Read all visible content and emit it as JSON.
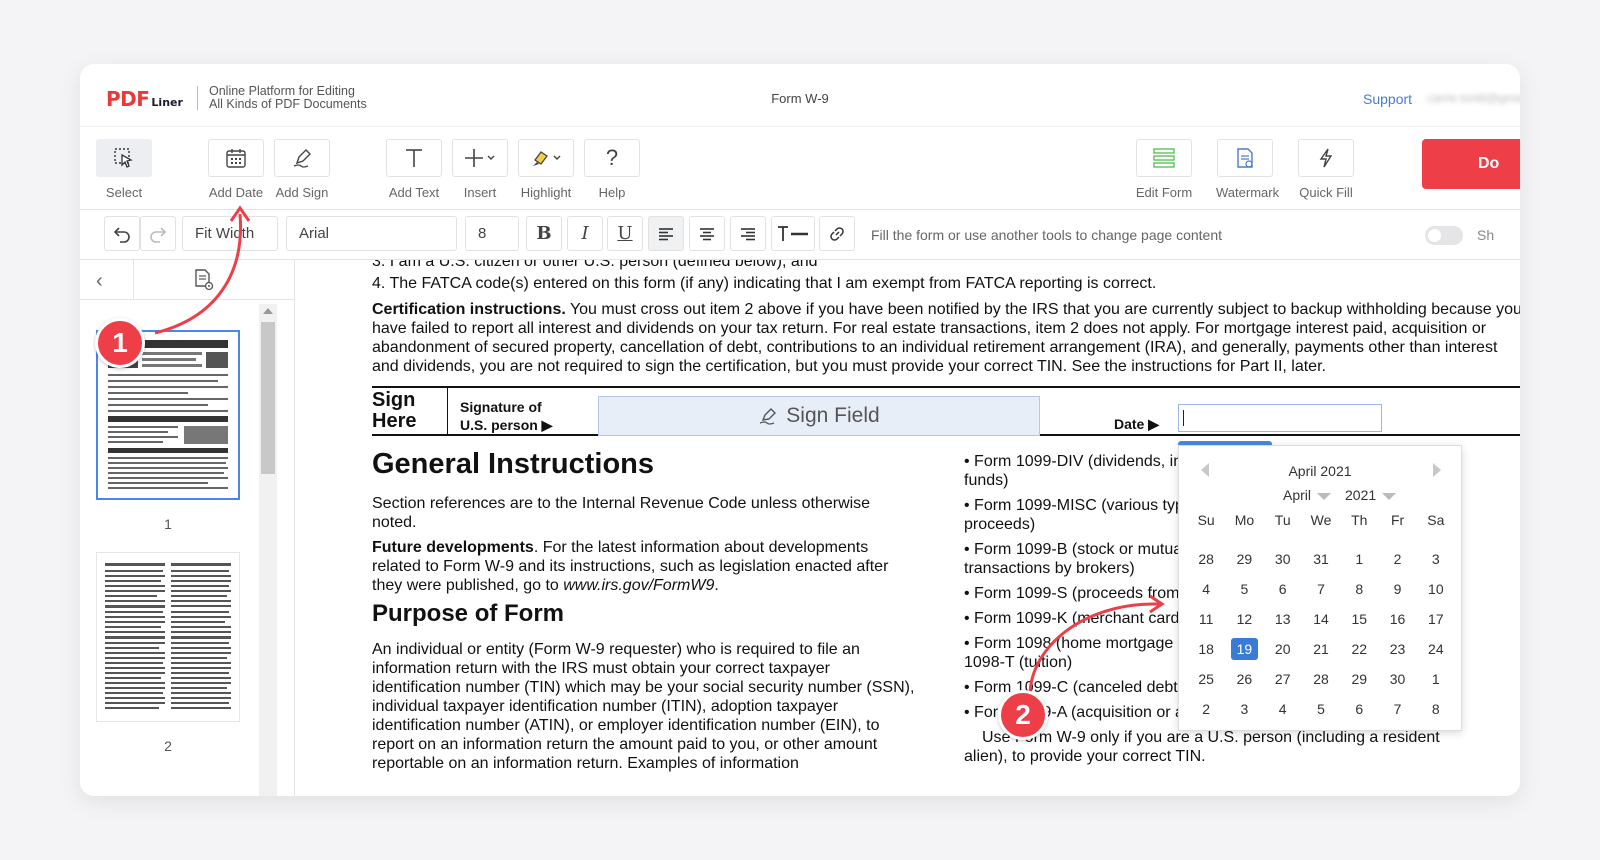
{
  "header": {
    "logo_main": "PDF",
    "logo_sub": "Liner",
    "tagline_line1": "Online Platform for Editing",
    "tagline_line2": "All Kinds of PDF Documents",
    "doc_title": "Form W-9",
    "support": "Support",
    "user_email": "carrie.tontit@gmail.com"
  },
  "toolbar": {
    "select": "Select",
    "add_date": "Add Date",
    "add_sign": "Add Sign",
    "add_text": "Add Text",
    "insert": "Insert",
    "highlight": "Highlight",
    "help": "Help",
    "edit_form": "Edit Form",
    "watermark": "Watermark",
    "quick_fill": "Quick Fill",
    "done": "Do"
  },
  "format": {
    "zoom": "Fit Width",
    "font": "Arial",
    "size": "8",
    "bold": "B",
    "italic": "I",
    "underline": "U",
    "hint": "Fill the form or use another tools to change page content",
    "toggle_label": "Sh"
  },
  "sidebar": {
    "pages": [
      "1",
      "2"
    ]
  },
  "document": {
    "line_top": "3. I am a U.S. citizen or other U.S. person (defined below); and",
    "line4": "4. The FATCA code(s) entered on this form (if any) indicating that I am exempt from FATCA reporting is correct.",
    "cert_bold": "Certification instructions.",
    "cert_text": " You must cross out item 2 above if you have been notified by the IRS that you are currently subject to backup withholding because you have failed to report all interest and dividends on your tax return. For real estate transactions, item 2 does not apply. For mortgage interest paid, acquisition or abandonment of secured property, cancellation of debt, contributions to an individual retirement arrangement (IRA), and generally, payments other than interest and dividends, you are not required to sign the certification, but you must provide your correct TIN. See the instructions for Part II, later.",
    "sign_here_1": "Sign",
    "sign_here_2": "Here",
    "sig_label_1": "Signature of",
    "sig_label_2": "U.S. person ▶",
    "sign_field": "Sign Field",
    "date_label": "Date ▶",
    "gi_title": "General Instructions",
    "gi_text": "Section references are to the Internal Revenue Code unless otherwise noted.",
    "fd_bold": "Future developments",
    "fd_text": ". For the latest information about developments related to Form W-9 and its instructions, such as legislation enacted after they were published, go to ",
    "fd_link": "www.irs.gov/FormW9",
    "fd_end": ".",
    "pf_title": "Purpose of Form",
    "pf_text": "An individual or entity (Form W-9 requester) who is required to file an information return with the IRS must obtain your correct taxpayer identification number (TIN) which may be your social security number (SSN), individual taxpayer identification number (ITIN), adoption taxpayer identification number (ATIN), or employer identification number (EIN), to report on an information return the amount paid to you, or other amount reportable on an information return. Examples of information",
    "bullets": [
      "• Form 1099-DIV (dividends, including those from stocks or mutual",
      "funds)",
      "• Form 1099-MISC (various types of income, prizes, awards, or gross",
      "proceeds)",
      "• Form 1099-B (stock or mutual fund sales and certain other",
      "transactions by brokers)",
      "• Form 1099-S (proceeds from real estate transactions)",
      "• Form 1099-K (merchant card and third party network transactions)",
      "• Form 1098 (home mortgage interest), 1098-E (student loan interest),",
      "1098-T (tuition)",
      "• Form 1099-C (canceled debt)",
      "• Form 1099-A (acquisition or abandonment of secured property)"
    ],
    "use_text_1": "Use Form W-9 only if you are a U.S. person (including a resident",
    "use_text_2": "alien), to provide your correct TIN."
  },
  "calendar": {
    "title": "April 2021",
    "month": "April",
    "year": "2021",
    "dow": [
      "Su",
      "Mo",
      "Tu",
      "We",
      "Th",
      "Fr",
      "Sa"
    ],
    "weeks": [
      [
        "28",
        "29",
        "30",
        "31",
        "1",
        "2",
        "3"
      ],
      [
        "4",
        "5",
        "6",
        "7",
        "8",
        "9",
        "10"
      ],
      [
        "11",
        "12",
        "13",
        "14",
        "15",
        "16",
        "17"
      ],
      [
        "18",
        "19",
        "20",
        "21",
        "22",
        "23",
        "24"
      ],
      [
        "25",
        "26",
        "27",
        "28",
        "29",
        "30",
        "1"
      ],
      [
        "2",
        "3",
        "4",
        "5",
        "6",
        "7",
        "8"
      ]
    ],
    "today": "19"
  },
  "annotations": {
    "step1": "1",
    "step2": "2"
  },
  "colors": {
    "brand": "#ee3e48",
    "accent": "#4a86e8",
    "link": "#4a7bd0"
  }
}
